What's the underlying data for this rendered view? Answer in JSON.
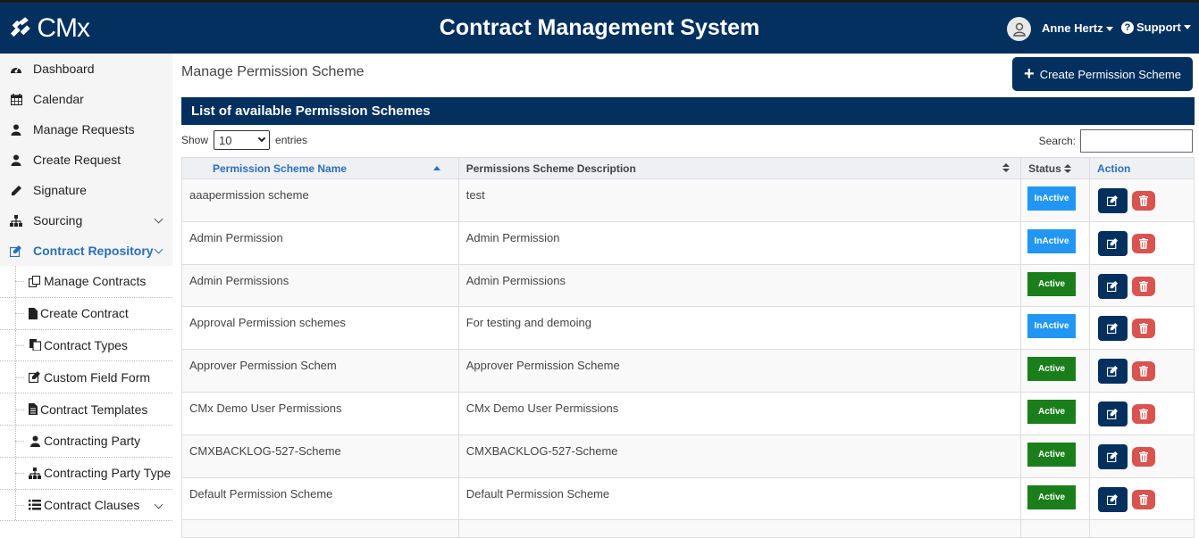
{
  "header": {
    "logo_text": "CMx",
    "app_title": "Contract Management System",
    "user_name": "Anne Hertz",
    "support_label": "Support"
  },
  "sidebar": {
    "items": [
      {
        "label": "Dashboard",
        "icon": "dashboard-icon"
      },
      {
        "label": "Calendar",
        "icon": "calendar-icon"
      },
      {
        "label": "Manage Requests",
        "icon": "user-icon"
      },
      {
        "label": "Create Request",
        "icon": "user-icon"
      },
      {
        "label": "Signature",
        "icon": "pencil-icon"
      },
      {
        "label": "Sourcing",
        "icon": "sitemap-icon"
      },
      {
        "label": "Contract Repository",
        "icon": "edit-icon"
      }
    ],
    "sub_items": [
      {
        "label": "Manage Contracts",
        "icon": "copy-icon"
      },
      {
        "label": "Create Contract",
        "icon": "file-icon"
      },
      {
        "label": "Contract Types",
        "icon": "files-icon"
      },
      {
        "label": "Custom Field Form",
        "icon": "edit-icon"
      },
      {
        "label": "Contract Templates",
        "icon": "file-text-icon"
      },
      {
        "label": "Contracting Party",
        "icon": "user-icon"
      },
      {
        "label": "Contracting Party Type",
        "icon": "sitemap-icon"
      },
      {
        "label": "Contract Clauses",
        "icon": "list-icon"
      }
    ]
  },
  "main": {
    "page_title": "Manage Permission Scheme",
    "create_button": "Create Permission Scheme",
    "panel_title": "List of available Permission Schemes",
    "show_label": "Show",
    "entries_value": "10",
    "entries_label": "entries",
    "search_label": "Search:",
    "search_value": ""
  },
  "table": {
    "columns": [
      "Permission Scheme Name",
      "Permissions Scheme Description",
      "Status",
      "Action"
    ],
    "rows": [
      {
        "name": "aaapermission scheme",
        "description": "test",
        "status": "InActive"
      },
      {
        "name": "Admin Permission",
        "description": "Admin Permission",
        "status": "InActive"
      },
      {
        "name": "Admin Permissions",
        "description": "Admin Permissions",
        "status": "Active"
      },
      {
        "name": "Approval Permission schemes",
        "description": "For testing and demoing",
        "status": "InActive"
      },
      {
        "name": "Approver Permission Schem",
        "description": "Approver Permission Scheme",
        "status": "Active"
      },
      {
        "name": "CMx Demo User Permissions",
        "description": "CMx Demo User Permissions",
        "status": "Active"
      },
      {
        "name": "CMXBACKLOG-527-Scheme",
        "description": "CMXBACKLOG-527-Scheme",
        "status": "Active"
      },
      {
        "name": "Default Permission Scheme",
        "description": "Default Permission Scheme",
        "status": "Active"
      }
    ]
  },
  "colors": {
    "brand_navy": "#03305e",
    "inactive_badge": "#2196f3",
    "active_badge": "#1a7f1a",
    "delete_red": "#d9534f",
    "link_blue": "#2a6fba"
  }
}
